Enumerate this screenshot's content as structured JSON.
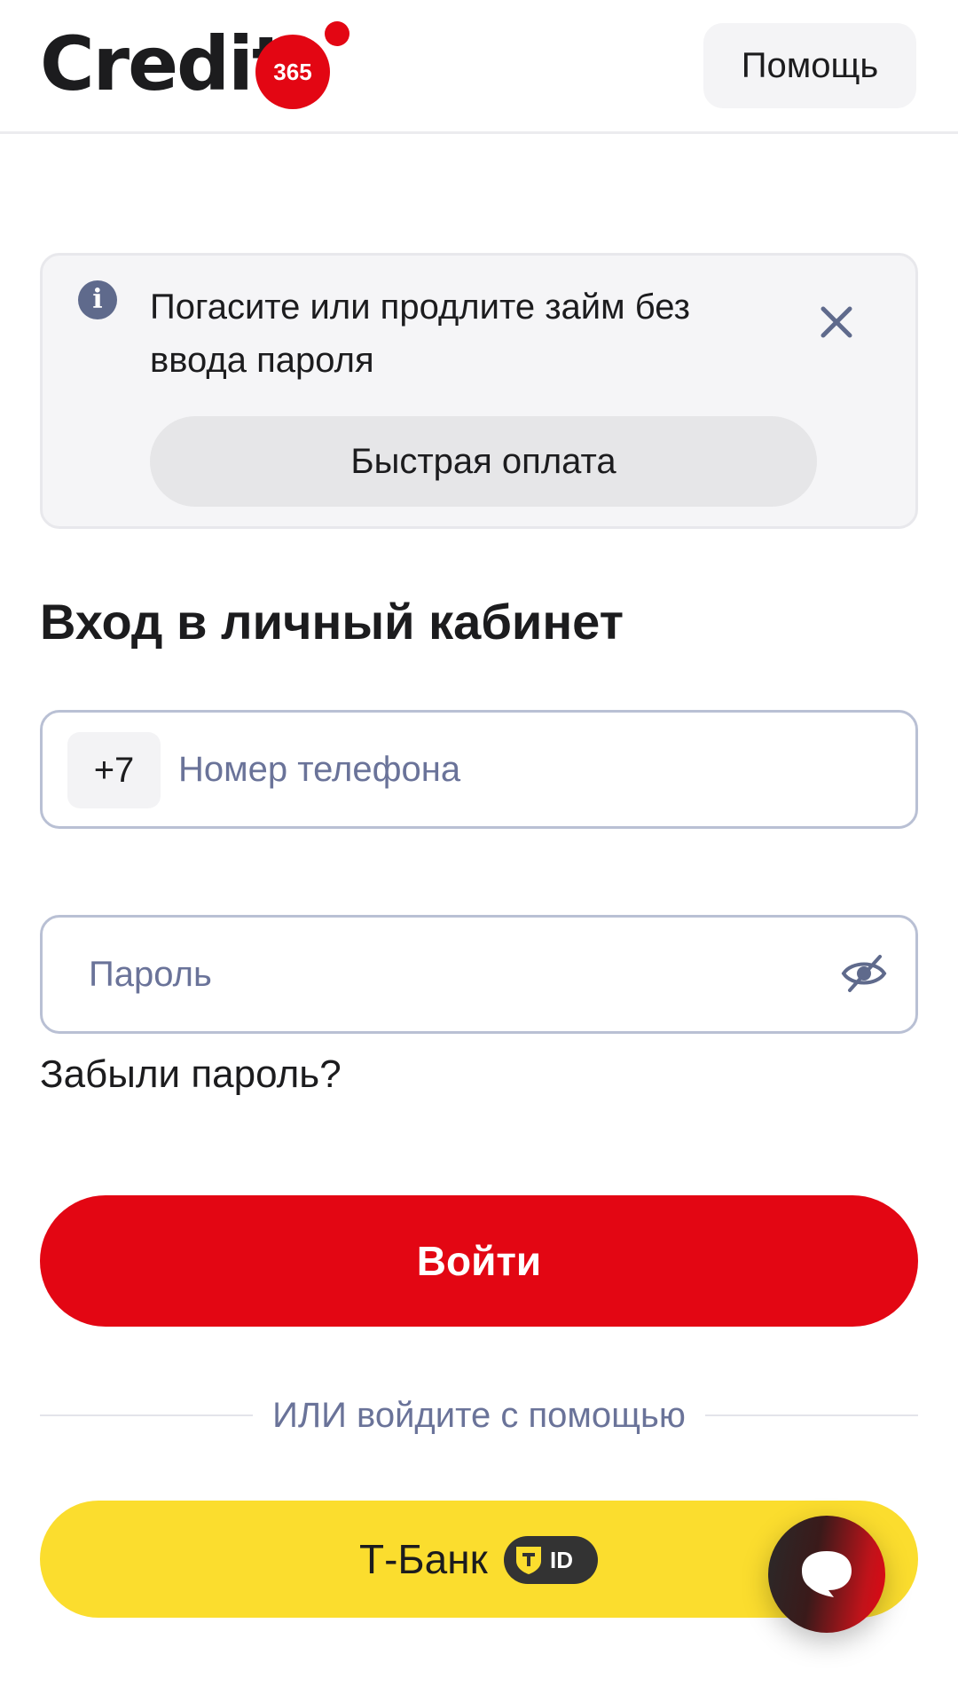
{
  "header": {
    "logo_text": "Credit",
    "logo_badge": "365",
    "help_label": "Помощь"
  },
  "notice": {
    "icon": "info-icon",
    "text": "Погасите или продлите займ без ввода пароля",
    "button_label": "Быстрая оплата",
    "close_icon": "close-icon"
  },
  "login": {
    "title": "Вход в личный кабинет",
    "phone": {
      "country_code": "+7",
      "placeholder": "Номер телефона",
      "value": ""
    },
    "password": {
      "placeholder": "Пароль",
      "value": "",
      "toggle_icon": "eye-off-icon"
    },
    "forgot_label": "Забыли пароль?",
    "submit_label": "Войти",
    "divider_text": "ИЛИ войдите с помощью",
    "tbank_label": "Т-Банк",
    "tbank_badge": "ID"
  },
  "chat": {
    "icon": "chat-bubble-icon"
  },
  "colors": {
    "brand_red": "#e30613",
    "tbank_yellow": "#fbdd2e",
    "muted_text": "#6a7399"
  }
}
